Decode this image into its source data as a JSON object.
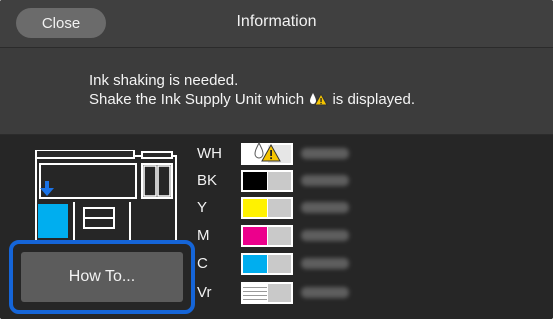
{
  "header": {
    "close_label": "Close",
    "title": "Information"
  },
  "message": {
    "line1": "Ink shaking is needed.",
    "line2_before_icon": "Shake the Ink Supply Unit which",
    "line2_icon": "ink-shake-warning-icon",
    "line2_after_icon": "is displayed."
  },
  "printer_illustration": {
    "icon": "printer-icon",
    "arrow_icon": "arrow-down-icon",
    "arrow_color": "#1a73e8",
    "highlight_color": "#00aeef"
  },
  "inks": [
    {
      "label": "WH",
      "color": "#ffffff",
      "warning": true,
      "warning_icon": "ink-shake-warning-icon"
    },
    {
      "label": "BK",
      "color": "#000000",
      "warning": false
    },
    {
      "label": "Y",
      "color": "#fff200",
      "warning": false
    },
    {
      "label": "M",
      "color": "#ec008c",
      "warning": false
    },
    {
      "label": "C",
      "color": "#00aeef",
      "warning": false
    },
    {
      "label": "Vr",
      "color": "#ffffff",
      "warning": false,
      "striped": true
    }
  ],
  "footer": {
    "howto_label": "How To...",
    "highlight_color": "#1565d8"
  }
}
